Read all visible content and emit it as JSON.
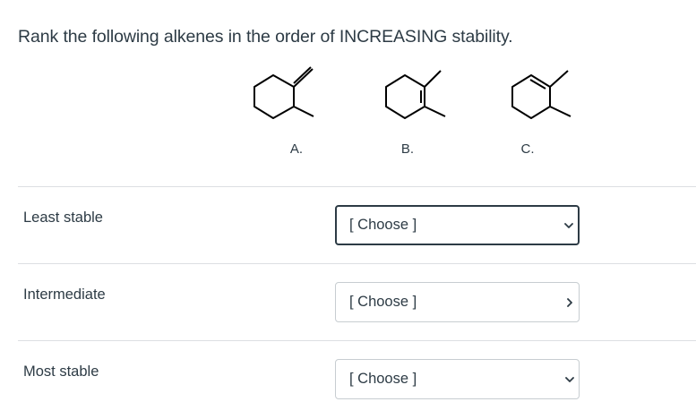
{
  "question": {
    "text": "Rank the following alkenes in the order of INCREASING stability."
  },
  "molecules": [
    {
      "label": "A."
    },
    {
      "label": "B."
    },
    {
      "label": "C."
    }
  ],
  "rows": [
    {
      "label": "Least stable",
      "select_value": "[ Choose ]",
      "focused": true
    },
    {
      "label": "Intermediate",
      "select_value": "[ Choose ]",
      "focused": false
    },
    {
      "label": "Most stable",
      "select_value": "[ Choose ]",
      "focused": false
    }
  ],
  "icons": {
    "dropdown": "chevron-down-icon"
  }
}
